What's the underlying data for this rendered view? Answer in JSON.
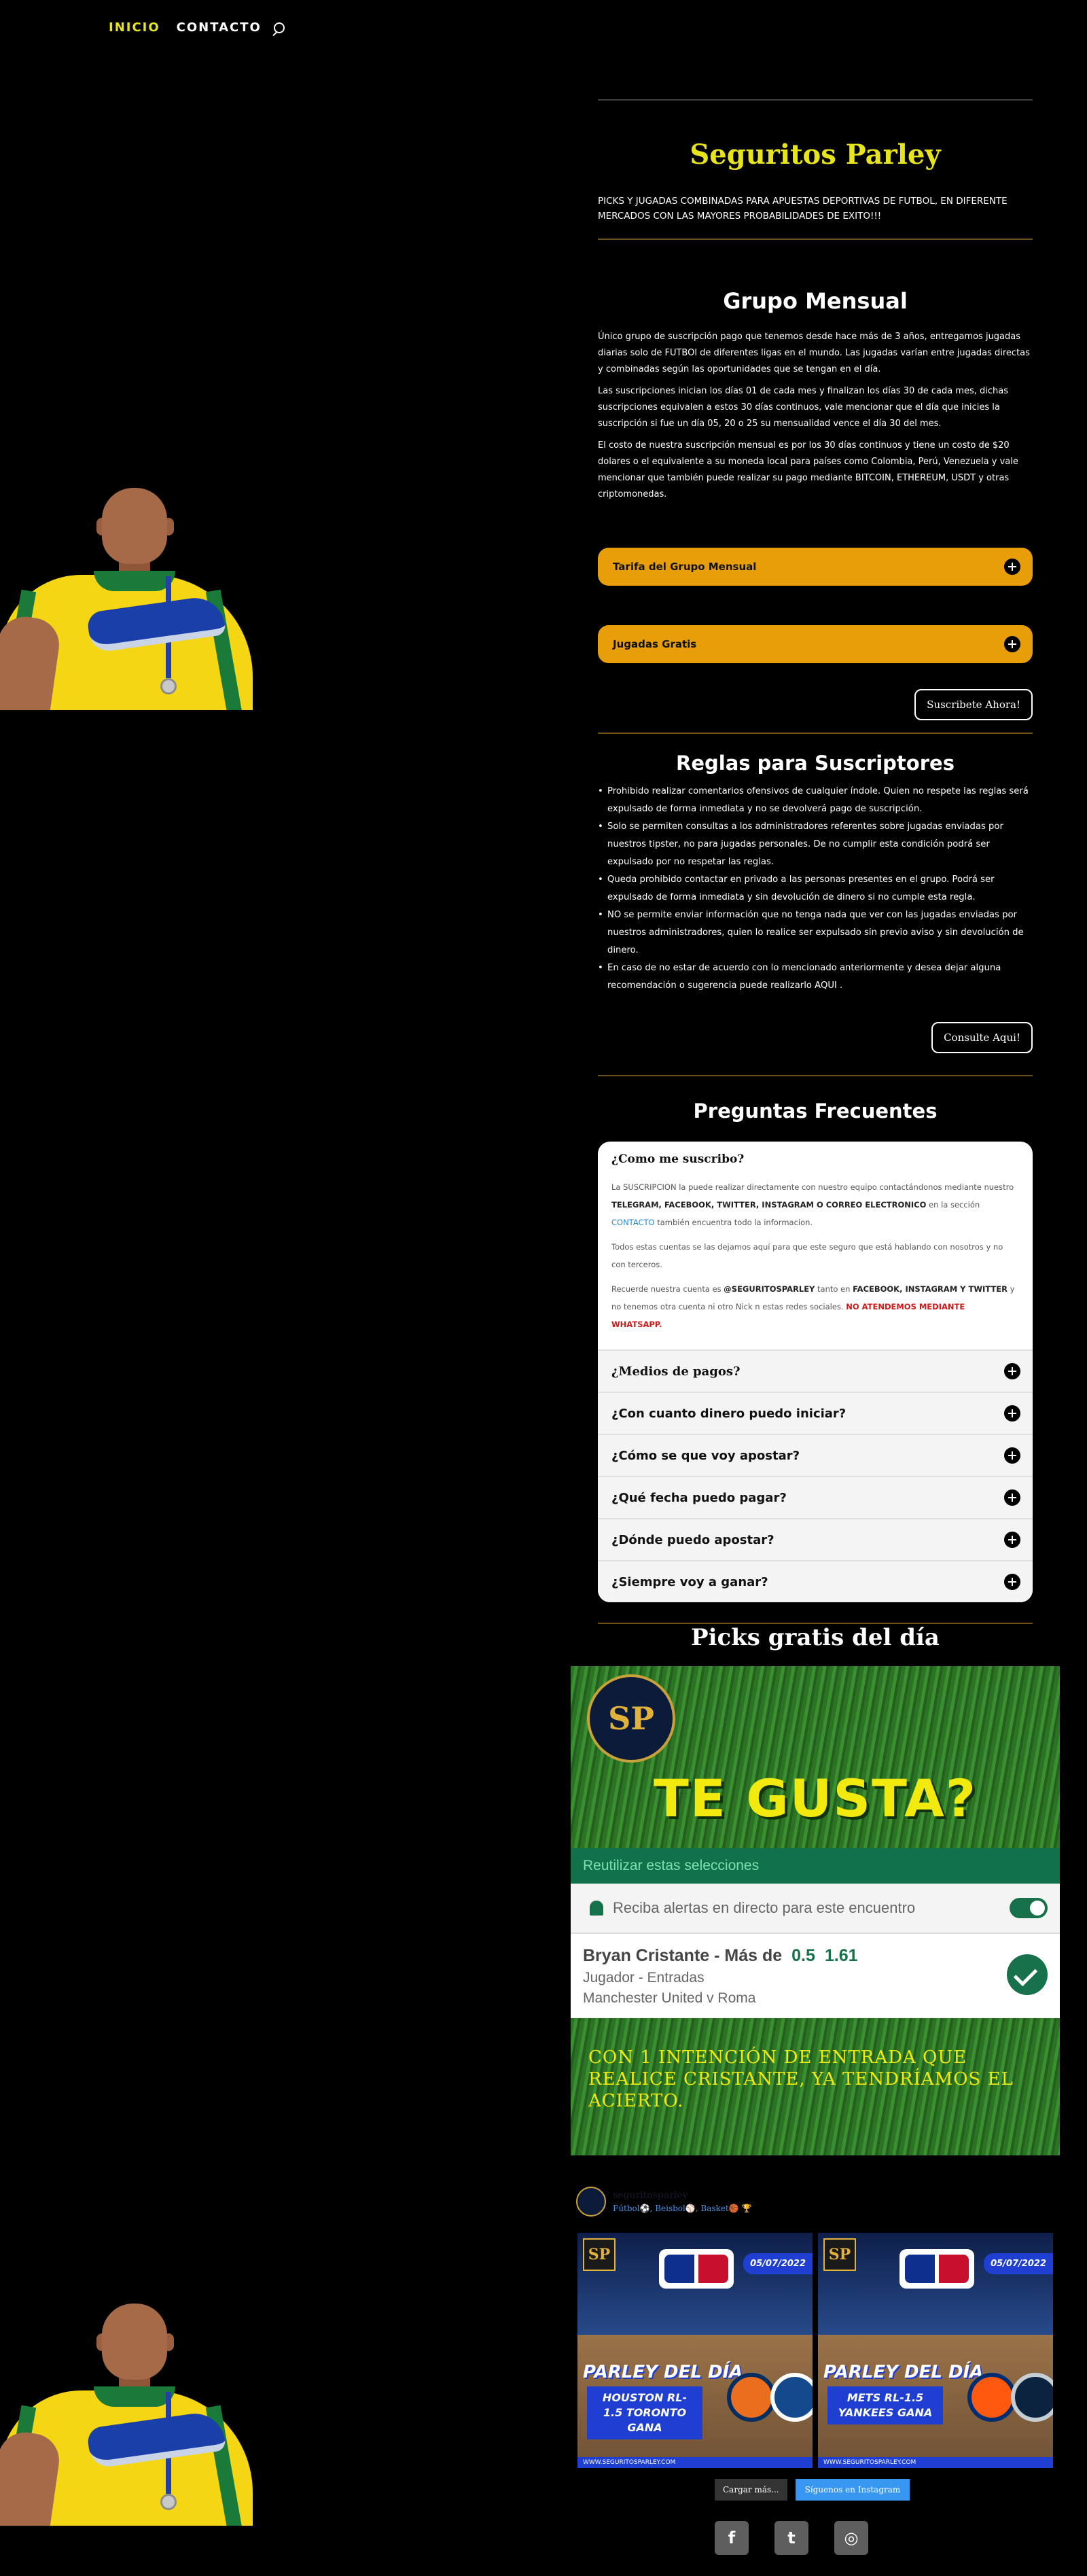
{
  "nav": {
    "inicio": "INICIO",
    "contacto": "CONTACTO"
  },
  "brand": {
    "title": "Seguritos Parley",
    "tagline": "PICKS Y JUGADAS COMBINADAS PARA APUESTAS DEPORTIVAS DE FUTBOL, EN DIFERENTE MERCADOS CON LAS MAYORES PROBABILIDADES DE EXITO!!!"
  },
  "grupo": {
    "title": "Grupo Mensual",
    "p1": "Único grupo de suscripción pago que tenemos desde hace más de 3 años, entregamos jugadas diarias solo de FUTBOl de diferentes ligas en el mundo. Las jugadas varían entre jugadas directas y combinadas según las oportunidades que se tengan en el día.",
    "p2": "Las suscripciones inician los días 01 de cada mes y finalizan los días 30 de cada mes, dichas suscripciones equivalen a estos 30 días continuos, vale mencionar que el día que inicies la suscripción si fue un día 05, 20 o 25 su mensualidad vence el día 30 del mes.",
    "p3": "El costo de nuestra suscripción mensual es por los 30 días continuos y tiene un costo de $20 dolares o el equivalente a su moneda local para países como Colombia, Perú, Venezuela y vale mencionar que también puede realizar su pago mediante BITCOIN, ETHEREUM, USDT y otras criptomonedas.",
    "acc1": "Tarifa del Grupo Mensual",
    "acc2": "Jugadas Gratis",
    "subscribe_btn": "Suscribete Ahora!"
  },
  "reglas": {
    "title": "Reglas para Suscriptores",
    "items": [
      "Prohibido realizar comentarios ofensivos de cualquier índole. Quien no respete las reglas será expulsado de forma inmediata y no se devolverá pago de suscripción.",
      "Solo se permiten consultas a los administradores referentes sobre jugadas enviadas por nuestros tipster, no para jugadas personales. De no cumplir esta condición podrá ser expulsado por no respetar las reglas.",
      "Queda prohibido contactar en privado a las personas presentes en el grupo. Podrá ser expulsado de forma inmediata y sin devolución de dinero si no cumple esta regla.",
      "NO se permite enviar información que no tenga nada que ver con las jugadas enviadas por nuestros administradores, quien lo realice ser expulsado sin previo aviso y sin devolución de dinero.",
      "En caso de no estar de acuerdo con lo mencionado anteriormente y desea dejar alguna recomendación o sugerencia puede realizarlo AQUI ."
    ],
    "consult_btn": "Consulte Aqui!"
  },
  "faq": {
    "title": "Preguntas Frecuentes",
    "open_q": "¿Como me suscribo?",
    "open_a1_pre": "La SUSCRIPCION la puede realizar directamente con nuestro equipo contactándonos mediante nuestro ",
    "open_a1_bold": "TELEGRAM, FACEBOOK, TWITTER, INSTAGRAM O CORREO ELECTRONICO",
    "open_a1_mid": " en la sección ",
    "open_a1_link": "CONTACTO",
    "open_a1_post": " también encuentra todo la informacion.",
    "open_a2": "Todos estas cuentas se las dejamos aquí para que este seguro que está hablando con nosotros y no con terceros.",
    "open_a3_pre": "Recuerde nuestra cuenta es ",
    "open_a3_b1": "@SEGURITOSPARLEY",
    "open_a3_mid": " tanto en ",
    "open_a3_b2": "FACEBOOK, INSTAGRAM Y TWITTER",
    "open_a3_post": " y no tenemos otra cuenta ni otro Nick n estas redes sociales. ",
    "open_a3_red": "NO ATENDEMOS MEDIANTE WHATSAPP.",
    "items": [
      "¿Medios de pagos?",
      "¿Con cuanto dinero puedo iniciar?",
      "¿Cómo se que voy apostar?",
      "¿Qué fecha puedo pagar?",
      "¿Dónde puedo apostar?",
      "¿Siempre voy a ganar?"
    ]
  },
  "picks": {
    "title": "Picks gratis del día",
    "logo": "SP",
    "headline": "TE GUSTA?",
    "reuse": "Reutilizar estas selecciones",
    "alert": "Reciba alertas en directo para este encuentro",
    "player": "Bryan Cristante - Más de",
    "line": "0.5",
    "odd": "1.61",
    "market": "Jugador - Entradas",
    "match": "Manchester United v Roma",
    "caption": "CON 1 INTENCIÓN DE ENTRADA QUE REALICE CRISTANTE, YA TENDRÍAMOS EL ACIERTO."
  },
  "instagram": {
    "user": "seguritosparley",
    "bio": "Fútbol⚽, Beisbol⚾, Basket🏀 🏆",
    "posts": [
      {
        "logo": "SP",
        "date": "05/07/2022",
        "title": "PARLEY DEL DÍA",
        "pick": "HOUSTON RL-1.5 TORONTO GANA",
        "foot": "WWW.SEGURITOSPARLEY.COM"
      },
      {
        "logo": "SP",
        "date": "05/07/2022",
        "title": "PARLEY DEL DÍA",
        "pick": "METS RL-1.5 YANKEES GANA",
        "foot": "WWW.SEGURITOSPARLEY.COM"
      }
    ],
    "load_more": "Cargar más...",
    "follow": "Síguenos en Instagram"
  },
  "social": {
    "facebook": "f",
    "twitter": "t",
    "instagram": "◎"
  }
}
